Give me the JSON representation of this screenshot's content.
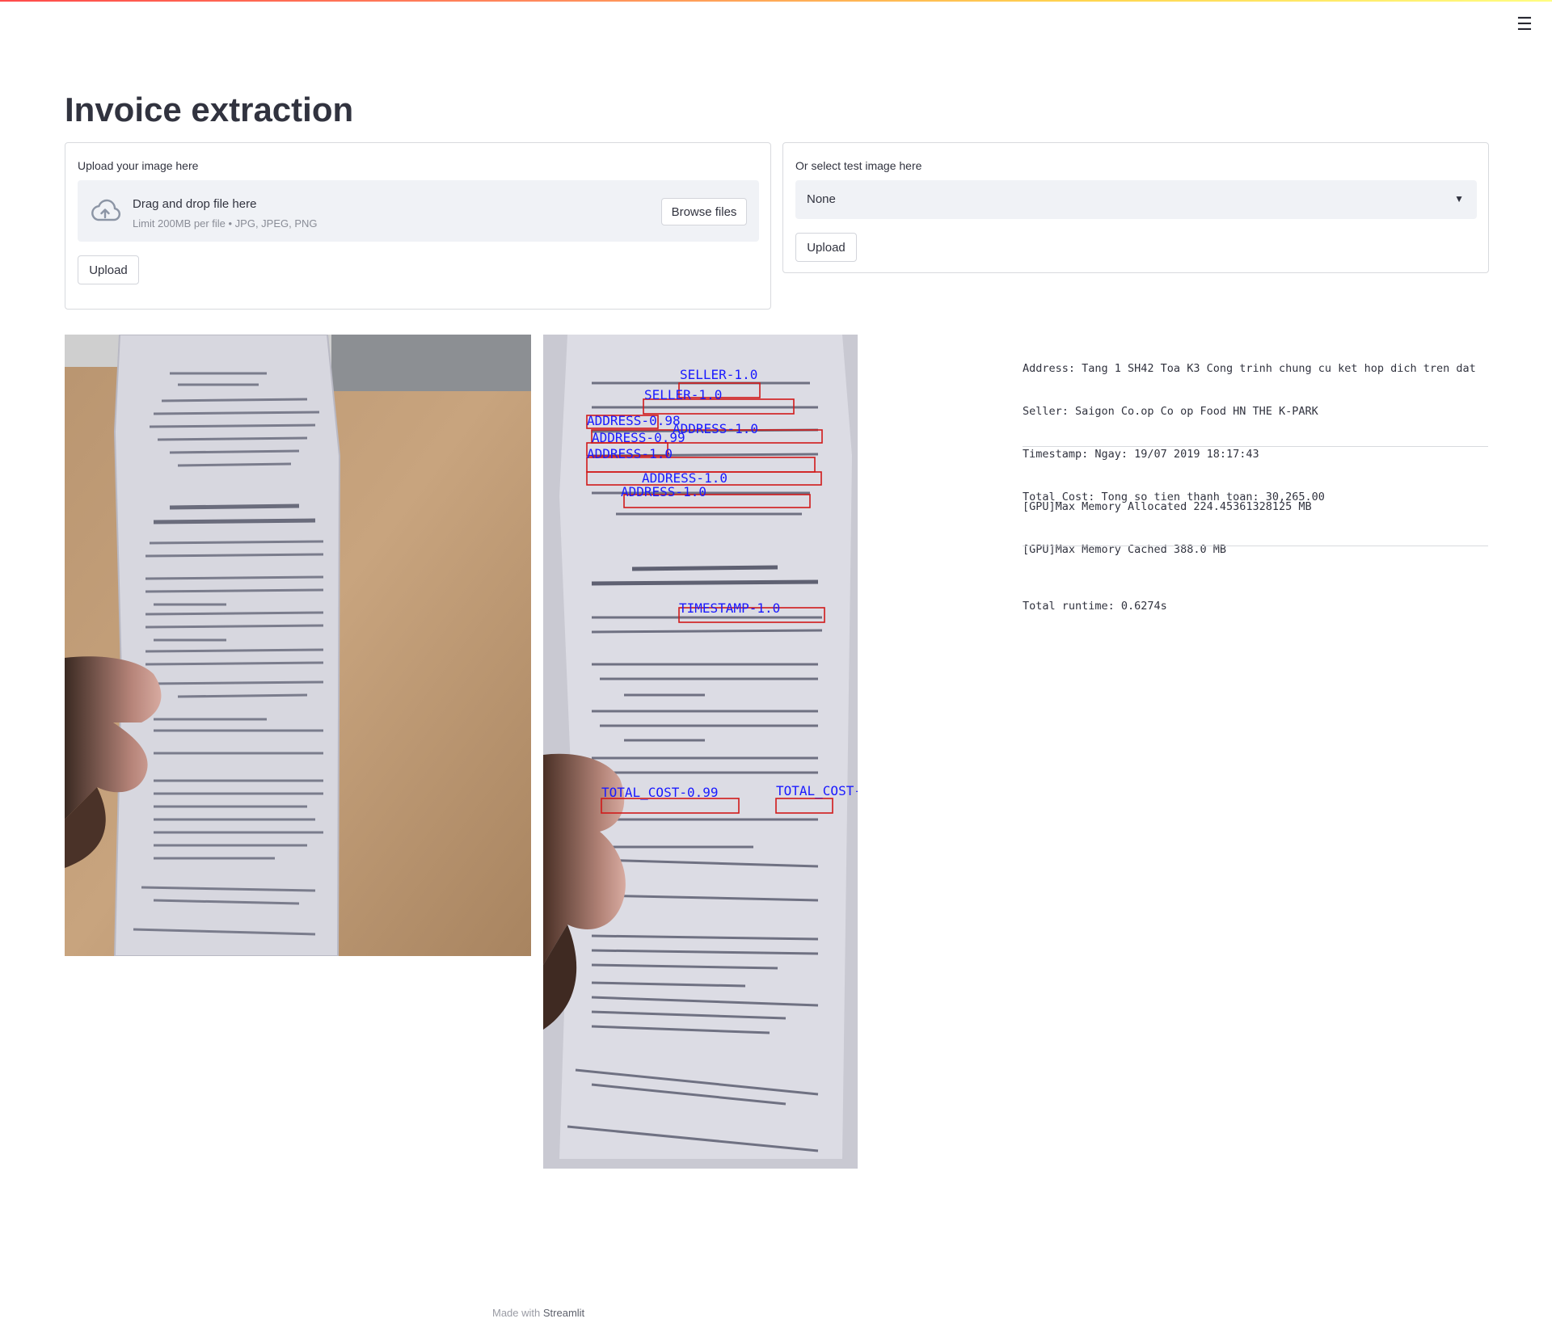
{
  "app": {
    "title": "Invoice extraction",
    "menu_icon": "hamburger-menu-icon"
  },
  "upload_panel": {
    "label": "Upload your image here",
    "dropzone_title": "Drag and drop file here",
    "dropzone_subtitle": "Limit 200MB per file • JPG, JPEG, PNG",
    "browse_label": "Browse files",
    "upload_label": "Upload",
    "icon": "cloud-upload-icon"
  },
  "select_panel": {
    "label": "Or select test image here",
    "selected": "None",
    "upload_label": "Upload",
    "icon": "chevron-down-icon"
  },
  "annotations": [
    {
      "label": "SELLER-1.0"
    },
    {
      "label": "SELLER-1.0"
    },
    {
      "label": "ADDRESS-0.98"
    },
    {
      "label": "ADDRESS-1.0"
    },
    {
      "label": "ADDRESS-0.99"
    },
    {
      "label": "ADDRESS-1.0"
    },
    {
      "label": "ADDRESS-1.0"
    },
    {
      "label": "ADDRESS-1.0"
    },
    {
      "label": "TIMESTAMP-1.0"
    },
    {
      "label": "TOTAL_COST-0.99"
    },
    {
      "label": "TOTAL_COST-"
    }
  ],
  "results": {
    "extracted": [
      "Address: Tang 1 SH42 Toa K3 Cong trinh chung cu ket hop dich tren dat",
      "Seller: Saigon Co.op Co op Food HN THE K-PARK",
      "Timestamp: Ngay: 19/07 2019 18:17:43",
      "Total_Cost: Tong so tien thanh toan: 30,265.00"
    ],
    "gpu": [
      "[GPU]Max Memory Allocated 224.45361328125 MB",
      "[GPU]Max Memory Cached 388.0 MB"
    ],
    "runtime": "Total runtime: 0.6274s"
  },
  "footer": {
    "prefix": "Made with",
    "brand": "Streamlit"
  },
  "colors": {
    "accent": "#ff4b4b",
    "box_red": "#d11a1a",
    "label_blue": "#1a1aff"
  }
}
